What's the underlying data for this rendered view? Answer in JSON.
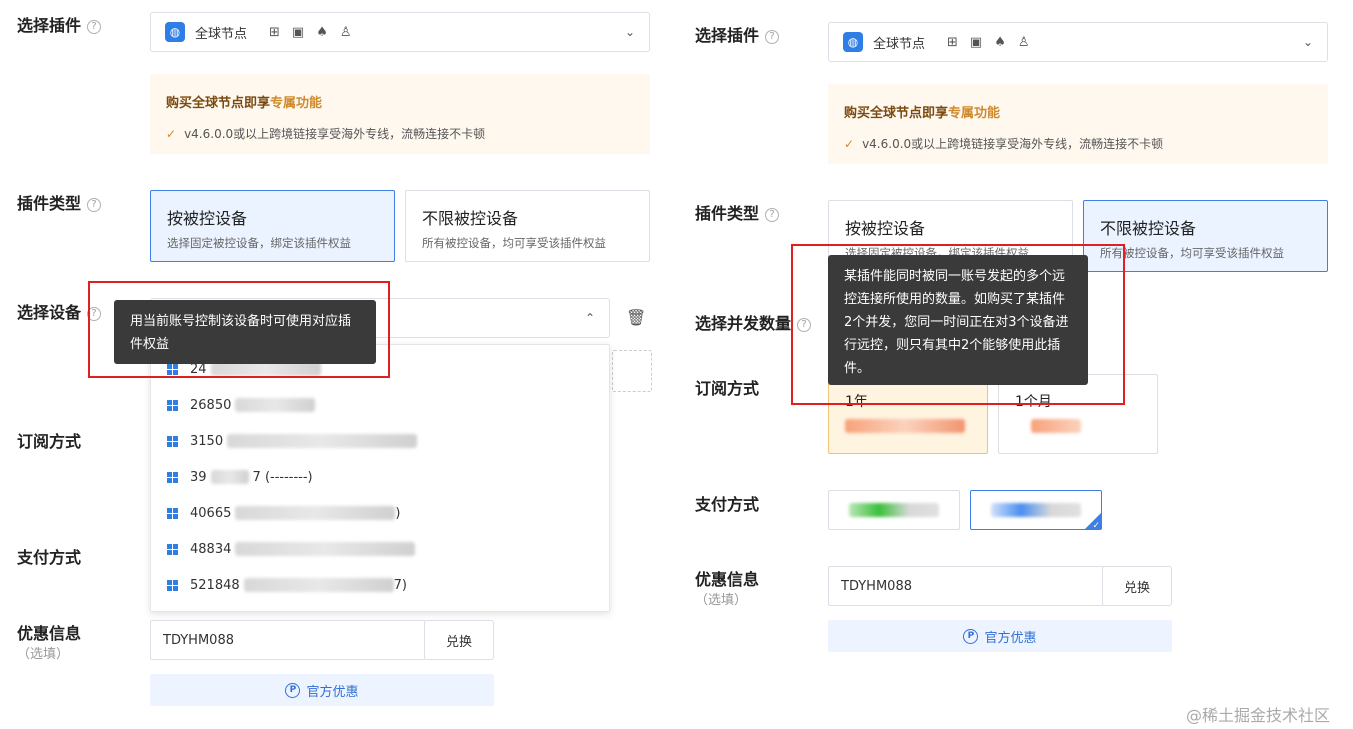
{
  "left": {
    "plugin_label": "选择插件",
    "plugin_select": "全球节点",
    "os_icons": [
      "windows-icon",
      "mac-icon",
      "android-icon",
      "linux-icon"
    ],
    "promo_title_prefix": "购买全球节点即享",
    "promo_title_highlight": "专属功能",
    "promo_line": "v4.6.0.0或以上跨境链接享受海外专线，流畅连接不卡顿",
    "type_label": "插件类型",
    "type_options": [
      {
        "title": "按被控设备",
        "desc": "选择固定被控设备，绑定该插件权益"
      },
      {
        "title": "不限被控设备",
        "desc": "所有被控设备，均可享受该插件权益"
      }
    ],
    "device_label": "选择设备",
    "tooltip": "用当前账号控制该设备时可使用对应插件权益",
    "devices": [
      "24",
      "26850",
      "3150",
      "39",
      "40665",
      "48834",
      "521848"
    ],
    "device_suffix_3": "7 (--------)",
    "device_suffix_4": ")",
    "device_suffix_6": "7)",
    "subscribe_label": "订阅方式",
    "payment_label": "支付方式",
    "coupon_label": "优惠信息",
    "coupon_optional": "（选填）",
    "coupon_code": "TDYHM088",
    "redeem_button": "兑换",
    "official_coupon": "官方优惠"
  },
  "right": {
    "plugin_label": "选择插件",
    "plugin_select": "全球节点",
    "promo_title_prefix": "购买全球节点即享",
    "promo_title_highlight": "专属功能",
    "promo_line": "v4.6.0.0或以上跨境链接享受海外专线，流畅连接不卡顿",
    "type_label": "插件类型",
    "type_options": [
      {
        "title": "按被控设备",
        "desc": "选择固定被控设备，绑定该插件权益"
      },
      {
        "title": "不限被控设备",
        "desc": "所有被控设备，均可享受该插件权益"
      }
    ],
    "concurrency_label": "选择并发数量",
    "tooltip": "某插件能同时被同一账号发起的多个远控连接所使用的数量。如购买了某插件2个并发，您同一时间正在对3个设备进行远控，则只有其中2个能够使用此插件。",
    "subscribe_label": "订阅方式",
    "subscribe_options": [
      "1年",
      "1个月"
    ],
    "payment_label": "支付方式",
    "coupon_label": "优惠信息",
    "coupon_optional": "（选填）",
    "coupon_code": "TDYHM088",
    "redeem_button": "兑换",
    "official_coupon": "官方优惠"
  },
  "watermark": "@稀土掘金技术社区"
}
